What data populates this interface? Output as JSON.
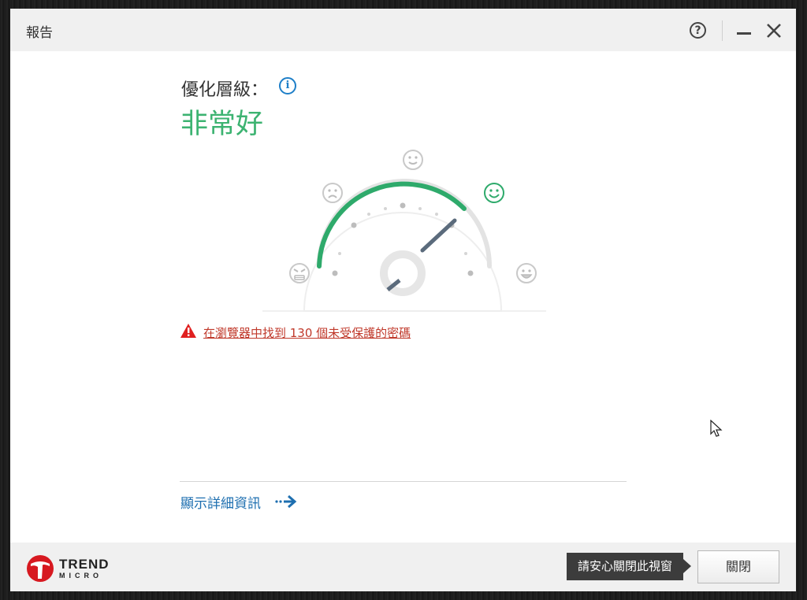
{
  "window": {
    "title": "報告",
    "help_label": "?"
  },
  "optimization": {
    "label": "優化層級：",
    "value": "非常好",
    "level": "very good",
    "accent_color": "#3cb371"
  },
  "gauge": {
    "levels": [
      "angry-face",
      "frown-face",
      "neutral-face",
      "smile-face",
      "grin-face"
    ],
    "active_level": "smile-face"
  },
  "alert": {
    "icon": "warning-icon",
    "text": "在瀏覽器中找到 130 個未受保護的密碼",
    "color": "#c0392b"
  },
  "details": {
    "label": "顯示詳細資訊",
    "icon": "arrow-right-icon"
  },
  "footer": {
    "brand_line1": "TREND",
    "brand_line2": "MICRO",
    "tooltip": "請安心關閉此視窗",
    "close_label": "關閉"
  }
}
